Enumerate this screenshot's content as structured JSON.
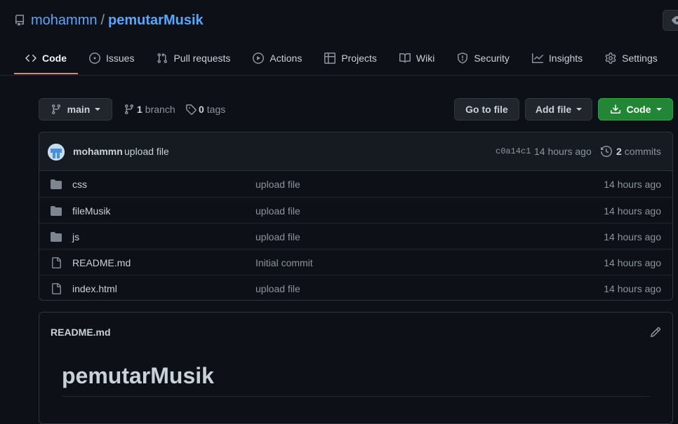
{
  "repo": {
    "owner": "mohammn",
    "separator": "/",
    "name": "pemutarMusik"
  },
  "tabs": [
    {
      "label": "Code",
      "icon": "code-icon",
      "active": true
    },
    {
      "label": "Issues",
      "icon": "issue-opened-icon"
    },
    {
      "label": "Pull requests",
      "icon": "git-pull-request-icon"
    },
    {
      "label": "Actions",
      "icon": "play-icon"
    },
    {
      "label": "Projects",
      "icon": "table-icon"
    },
    {
      "label": "Wiki",
      "icon": "book-icon"
    },
    {
      "label": "Security",
      "icon": "shield-icon"
    },
    {
      "label": "Insights",
      "icon": "graph-icon"
    },
    {
      "label": "Settings",
      "icon": "gear-icon"
    }
  ],
  "branch": {
    "current": "main",
    "branch_count": "1",
    "branch_label": "branch",
    "tag_count": "0",
    "tag_label": "tags"
  },
  "actions": {
    "go_to_file": "Go to file",
    "add_file": "Add file",
    "code": "Code"
  },
  "commit": {
    "author": "mohammn",
    "message": "upload file",
    "sha": "c0a14c1",
    "time": "14 hours ago",
    "count": "2",
    "count_label": "commits"
  },
  "files": [
    {
      "type": "folder",
      "name": "css",
      "message": "upload file",
      "time": "14 hours ago"
    },
    {
      "type": "folder",
      "name": "fileMusik",
      "message": "upload file",
      "time": "14 hours ago"
    },
    {
      "type": "folder",
      "name": "js",
      "message": "upload file",
      "time": "14 hours ago"
    },
    {
      "type": "file",
      "name": "README.md",
      "message": "Initial commit",
      "time": "14 hours ago"
    },
    {
      "type": "file",
      "name": "index.html",
      "message": "upload file",
      "time": "14 hours ago"
    }
  ],
  "readme": {
    "filename": "README.md",
    "heading": "pemutarMusik"
  },
  "colors": {
    "accent_link": "#58a6ff",
    "active_tab_border": "#f78166",
    "code_button": "#238636",
    "background": "#0d1117"
  }
}
